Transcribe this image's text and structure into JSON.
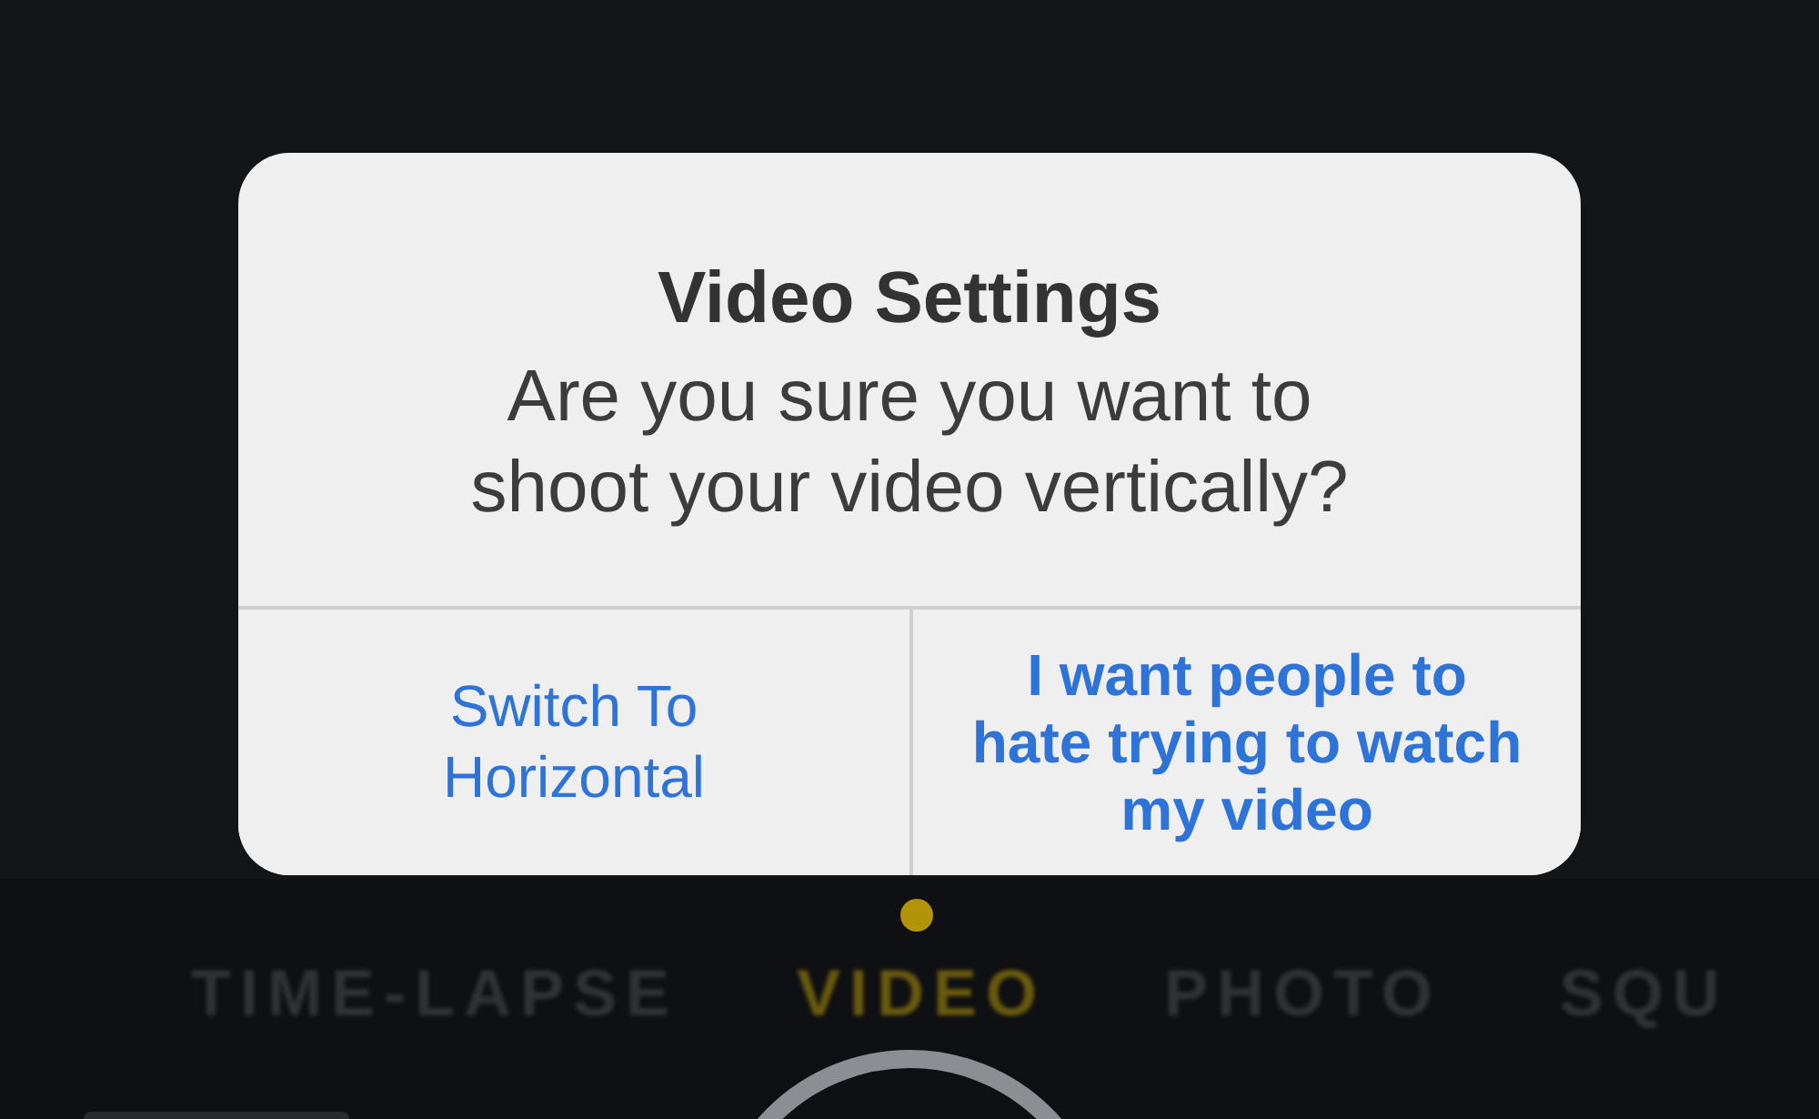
{
  "alert": {
    "title": "Video Settings",
    "message": "Are you sure you want to shoot your video vertically?",
    "buttons": [
      {
        "label": "Switch To Horizontal",
        "kind": "normal"
      },
      {
        "label": "I want people to hate trying to watch my video",
        "kind": "preferred"
      }
    ]
  },
  "camera_modes": [
    {
      "label": "TIME-LAPSE",
      "selected": false
    },
    {
      "label": "VIDEO",
      "selected": true
    },
    {
      "label": "PHOTO",
      "selected": false
    },
    {
      "label": "SQU",
      "selected": false
    }
  ]
}
